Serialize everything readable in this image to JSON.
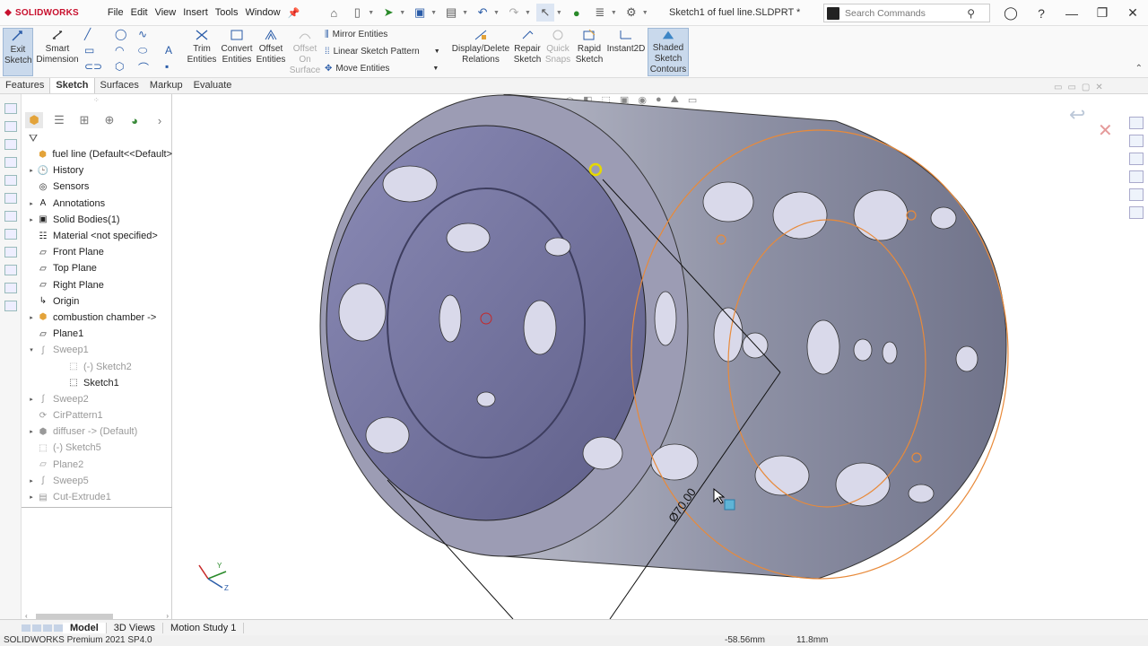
{
  "app": {
    "brand": "SOLIDWORKS",
    "doc_title": "Sketch1 of fuel line.SLDPRT *"
  },
  "menu": [
    "File",
    "Edit",
    "View",
    "Insert",
    "Tools",
    "Window"
  ],
  "search": {
    "placeholder": "Search Commands"
  },
  "ribbon": {
    "exit_sketch": "Exit Sketch",
    "smart_dimension": "Smart Dimension",
    "trim": "Trim Entities",
    "convert": "Convert Entities",
    "offset": "Offset Entities",
    "offset_surface": "Offset On Surface",
    "mirror": "Mirror Entities",
    "linear_pattern": "Linear Sketch Pattern",
    "move": "Move Entities",
    "display_delete": "Display/Delete Relations",
    "repair": "Repair Sketch",
    "quick_snaps": "Quick Snaps",
    "rapid": "Rapid Sketch",
    "instant2d": "Instant2D",
    "shaded": "Shaded Sketch Contours"
  },
  "command_tabs": [
    "Features",
    "Sketch",
    "Surfaces",
    "Markup",
    "Evaluate"
  ],
  "active_tab": "Sketch",
  "tree": [
    {
      "label": "fuel line  (Default<<Default>",
      "icon": "part-icon",
      "exp": ""
    },
    {
      "label": "History",
      "icon": "history-icon",
      "exp": "▸"
    },
    {
      "label": "Sensors",
      "icon": "sensor-icon",
      "exp": ""
    },
    {
      "label": "Annotations",
      "icon": "annotation-icon",
      "exp": "▸"
    },
    {
      "label": "Solid Bodies(1)",
      "icon": "solid-bodies-icon",
      "exp": "▸"
    },
    {
      "label": "Material <not specified>",
      "icon": "material-icon",
      "exp": ""
    },
    {
      "label": "Front Plane",
      "icon": "plane-icon",
      "exp": ""
    },
    {
      "label": "Top Plane",
      "icon": "plane-icon",
      "exp": ""
    },
    {
      "label": "Right Plane",
      "icon": "plane-icon",
      "exp": ""
    },
    {
      "label": "Origin",
      "icon": "origin-icon",
      "exp": ""
    },
    {
      "label": "combustion chamber ->",
      "icon": "part-icon",
      "exp": "▸"
    },
    {
      "label": "Plane1",
      "icon": "plane-icon",
      "exp": ""
    },
    {
      "label": "Sweep1",
      "icon": "sweep-icon",
      "exp": "▾",
      "suppressed": true
    },
    {
      "label": "(-) Sketch2",
      "icon": "sketch-icon",
      "exp": "",
      "indent": 1,
      "suppressed": true
    },
    {
      "label": "Sketch1",
      "icon": "sketch-icon",
      "exp": "",
      "indent": 1
    },
    {
      "label": "Sweep2",
      "icon": "sweep-icon",
      "exp": "▸",
      "suppressed": true
    },
    {
      "label": "CirPattern1",
      "icon": "pattern-icon",
      "exp": "",
      "suppressed": true
    },
    {
      "label": "diffuser -> (Default)",
      "icon": "part-icon",
      "exp": "▸",
      "suppressed": true
    },
    {
      "label": "(-) Sketch5",
      "icon": "sketch-icon",
      "exp": "",
      "suppressed": true
    },
    {
      "label": "Plane2",
      "icon": "plane-icon",
      "exp": "",
      "suppressed": true
    },
    {
      "label": "Sweep5",
      "icon": "sweep-icon",
      "exp": "▸",
      "suppressed": true
    },
    {
      "label": "Cut-Extrude1",
      "icon": "extrude-icon",
      "exp": "▸",
      "suppressed": true
    }
  ],
  "dimension": "Ø70.00",
  "bottom_tabs": [
    "Model",
    "3D Views",
    "Motion Study 1"
  ],
  "status": {
    "version": "SOLIDWORKS Premium 2021 SP4.0",
    "x": "-58.56mm",
    "y": "11.8mm"
  },
  "colors": {
    "part": "#5a5f78",
    "inner": "#6f6e9e",
    "sketch": "#e88a3a"
  }
}
